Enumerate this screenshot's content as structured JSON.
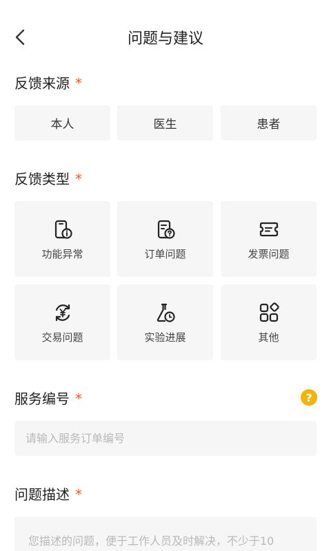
{
  "nav": {
    "title": "问题与建议",
    "back_icon": "chevron-left-icon"
  },
  "source": {
    "label": "反馈来源",
    "required_mark": "*",
    "options": [
      "本人",
      "医生",
      "患者"
    ]
  },
  "type": {
    "label": "反馈类型",
    "required_mark": "*",
    "options": [
      {
        "label": "功能异常",
        "icon": "phone-info-icon"
      },
      {
        "label": "订单问题",
        "icon": "order-question-icon"
      },
      {
        "label": "发票问题",
        "icon": "ticket-icon"
      },
      {
        "label": "交易问题",
        "icon": "yen-exchange-icon"
      },
      {
        "label": "实验进展",
        "icon": "flask-clock-icon"
      },
      {
        "label": "其他",
        "icon": "apps-icon"
      }
    ]
  },
  "service_no": {
    "label": "服务编号",
    "required_mark": "*",
    "help_icon": "question-circle-icon",
    "help_glyph": "?",
    "placeholder": "请输入服务订单编号"
  },
  "description": {
    "label": "问题描述",
    "required_mark": "*",
    "placeholder": "您描述的问题，便于工作人员及时解决，不少于10"
  },
  "colors": {
    "accent_required": "#ff5a1f",
    "help": "#f5b400",
    "chip_bg": "#f6f6f6"
  }
}
